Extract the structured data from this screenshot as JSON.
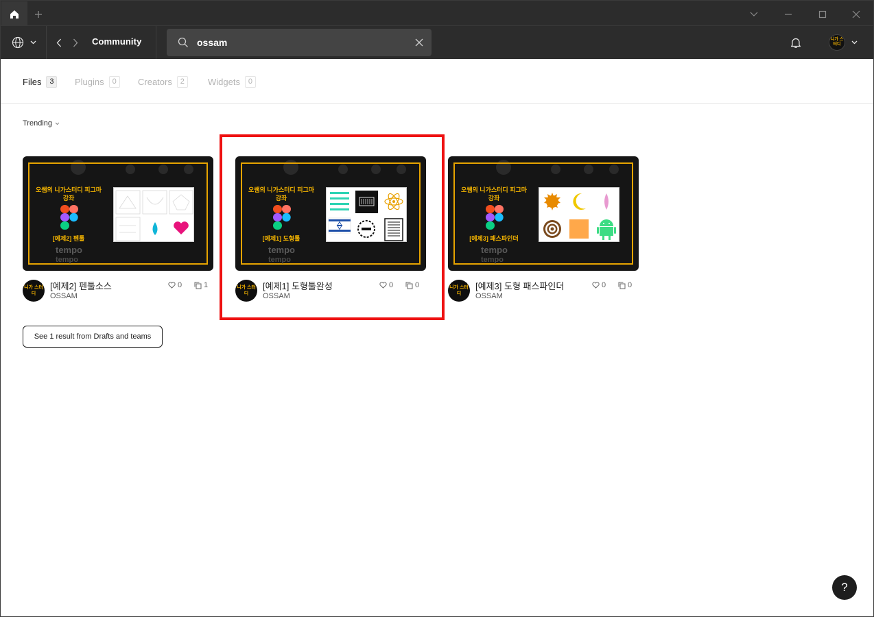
{
  "titlebar": {
    "icons": [
      "home-icon",
      "plus-icon",
      "chevron-down-icon",
      "minimize-icon",
      "maximize-icon",
      "close-icon"
    ]
  },
  "toolbar": {
    "breadcrumb": "Community",
    "search_value": "ossam",
    "avatar_text": "니가 스터디"
  },
  "tabs": [
    {
      "label": "Files",
      "count": "3",
      "active": true
    },
    {
      "label": "Plugins",
      "count": "0",
      "active": false
    },
    {
      "label": "Creators",
      "count": "2",
      "active": false
    },
    {
      "label": "Widgets",
      "count": "0",
      "active": false
    }
  ],
  "sort": {
    "label": "Trending"
  },
  "cards": [
    {
      "title": "[예제2] 펜툴소스",
      "author": "OSSAM",
      "likes": "0",
      "duplicates": "1",
      "thumb_title": "오쌤의 니가스터디 피그마 강좌",
      "thumb_sub": "[예제2] 펜툴",
      "avatar_text": "니가 스터디"
    },
    {
      "title": "[예제1] 도형툴완성",
      "author": "OSSAM",
      "likes": "0",
      "duplicates": "0",
      "thumb_title": "오쌤의 니가스터디 피그마 강좌",
      "thumb_sub": "[예제1] 도형툴",
      "avatar_text": "니가 스터디"
    },
    {
      "title": "[예제3] 도형 패스파인더",
      "author": "OSSAM",
      "likes": "0",
      "duplicates": "0",
      "thumb_title": "오쌤의 니가스터디 피그마 강좌",
      "thumb_sub": "[예제3] 패스파인더",
      "avatar_text": "니가 스터디"
    }
  ],
  "thumb_word": "tempo",
  "drafts_button": "See 1 result from Drafts and teams",
  "help_label": "?",
  "colors": {
    "chrome": "#2c2c2c",
    "accent": "#f4b400",
    "highlight": "#ee1111"
  }
}
